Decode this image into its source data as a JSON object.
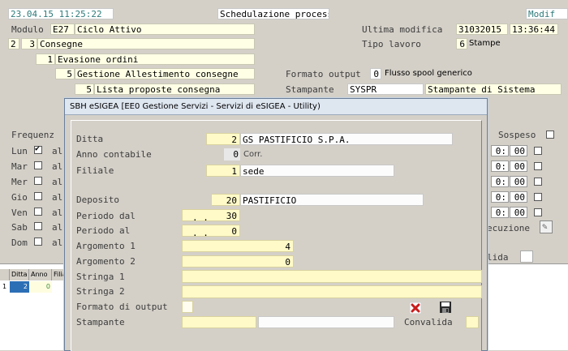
{
  "header": {
    "datetime": "23.04.15 11:25:22",
    "title": "Schedulazione processi",
    "mode": "Modif"
  },
  "bg": {
    "modulo_label": "Modulo",
    "modulo_code": "E27",
    "modulo_name": "Ciclo Attivo",
    "ultima_modifica_label": "Ultima modifica",
    "ultima_modifica_date": "31032015",
    "ultima_modifica_time": "13:36:44",
    "tipo_lavoro_label": "Tipo lavoro",
    "tipo_lavoro_code": "6",
    "tipo_lavoro_name": "Stampe",
    "tree": [
      {
        "num": "2",
        "sub": "3",
        "label": "Consegne"
      },
      {
        "num": "1",
        "label": "Evasione ordini"
      },
      {
        "num": "5",
        "label": "Gestione Allestimento consegne"
      },
      {
        "num": "5",
        "label": "Lista proposte consegna"
      }
    ],
    "formato_label": "Formato output",
    "formato_code": "0",
    "formato_name": "Flusso spool generico",
    "stampante_label": "Stampante",
    "stampante_code": "SYSPR",
    "stampante_name": "Stampante di Sistema",
    "frequenza_label": "Frequenz",
    "sospeso_label": "Sospeso",
    "days": [
      {
        "label": "Lun",
        "al": "al",
        "checked": true
      },
      {
        "label": "Mar",
        "al": "al",
        "checked": false
      },
      {
        "label": "Mer",
        "al": "al",
        "checked": false
      },
      {
        "label": "Gio",
        "al": "al",
        "checked": false
      },
      {
        "label": "Ven",
        "al": "al",
        "checked": false
      },
      {
        "label": "Sab",
        "al": "al",
        "checked": false
      },
      {
        "label": "Dom",
        "al": "al",
        "checked": false
      }
    ],
    "times": [
      {
        "h": "0:",
        "m": "00"
      },
      {
        "h": "0:",
        "m": "00"
      },
      {
        "h": "0:",
        "m": "00"
      },
      {
        "h": "0:",
        "m": "00"
      },
      {
        "h": "0:",
        "m": "00"
      }
    ],
    "esecuzione_label": "ecuzione",
    "convalida_label": "lida",
    "table_headers": [
      "Ditta",
      "Anno",
      "Filial"
    ],
    "table_row": {
      "idx": "1",
      "ditta": "2",
      "anno": "0"
    }
  },
  "dialog": {
    "title": "SBH eSIGEA [EE0 Gestione Servizi - Servizi di eSIGEA - Utility)",
    "ditta_label": "Ditta",
    "ditta_code": "2",
    "ditta_name": "GS PASTIFICIO S.P.A.",
    "anno_label": "Anno contabile",
    "anno_value": "0",
    "anno_note": "Corr.",
    "filiale_label": "Filiale",
    "filiale_code": "1",
    "filiale_name": "sede",
    "deposito_label": "Deposito",
    "deposito_code": "20",
    "deposito_name": "PASTIFICIO",
    "periodo_dal_label": "Periodo dal",
    "periodo_dal_prefix": ". .",
    "periodo_dal_value": "30",
    "periodo_al_label": "Periodo  al",
    "periodo_al_prefix": ". .",
    "periodo_al_value": "0",
    "arg1_label": "Argomento 1",
    "arg1_value": "4",
    "arg2_label": "Argomento 2",
    "arg2_value": "0",
    "stringa1_label": "Stringa  1",
    "stringa1_value": "",
    "stringa2_label": "Stringa  2",
    "stringa2_value": "",
    "formato_label": "Formato di output",
    "formato_value": "",
    "stampante_label": "Stampante",
    "stampante_code": "",
    "stampante_name": "",
    "convalida_label": "Convalida",
    "delete_icon": "red-x-icon",
    "save_icon": "floppy-disk-icon"
  }
}
